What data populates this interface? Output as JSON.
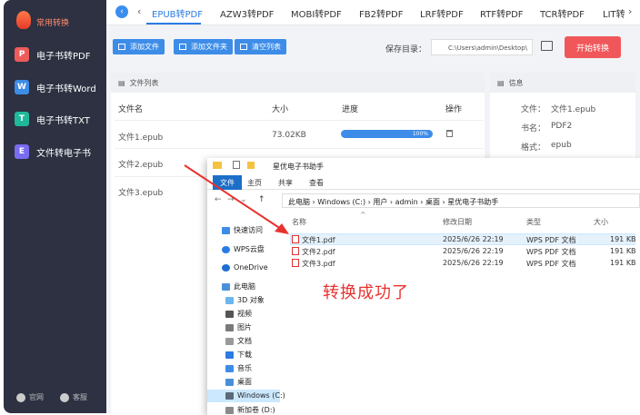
{
  "sidebar": {
    "logo_text": "常用转换",
    "items": [
      {
        "icon": "P",
        "label": "电子书转PDF",
        "color": "#ef5b5b"
      },
      {
        "icon": "W",
        "label": "电子书转Word",
        "color": "#3d8ce8"
      },
      {
        "icon": "T",
        "label": "电子书转TXT",
        "color": "#1fb89a"
      },
      {
        "icon": "E",
        "label": "文件转电子书",
        "color": "#7a6cf0"
      }
    ],
    "footer": [
      "官网",
      "客服"
    ]
  },
  "tabs": [
    "EPUB转PDF",
    "AZW3转PDF",
    "MOBI转PDF",
    "FB2转PDF",
    "LRF转PDF",
    "RTF转PDF",
    "TCR转PDF",
    "LIT转"
  ],
  "toolbar": {
    "add_file": "添加文件",
    "add_folder": "添加文件夹",
    "clear_list": "清空列表",
    "save_label": "保存目录：",
    "save_path": "C:\\Users\\admin\\Desktop\\",
    "start": "开始转换"
  },
  "file_list": {
    "title": "文件列表",
    "columns": [
      "文件名",
      "大小",
      "进度",
      "操作"
    ],
    "rows": [
      {
        "name": "文件1.epub",
        "size": "73.02KB",
        "progress": "100%"
      },
      {
        "name": "文件2.epub"
      },
      {
        "name": "文件3.epub"
      }
    ]
  },
  "info": {
    "title": "信息",
    "file_label": "文件：",
    "file_value": "文件1.epub",
    "book_label": "书名：",
    "book_value": "PDF2",
    "format_label": "格式：",
    "format_value": "epub"
  },
  "explorer": {
    "title": "星优电子书助手",
    "ribbon": [
      "文件",
      "主页",
      "共享",
      "查看"
    ],
    "breadcrumb": "此电脑 › Windows (C:) › 用户 › admin › 桌面 › 星优电子书助手",
    "nav_items": [
      "快速访问",
      "WPS云盘",
      "OneDrive",
      "此电脑",
      "3D 对象",
      "视频",
      "图片",
      "文档",
      "下载",
      "音乐",
      "桌面",
      "Windows (C:)",
      "新加卷 (D:)"
    ],
    "columns": [
      "名称",
      "修改日期",
      "类型",
      "大小"
    ],
    "files": [
      {
        "name": "文件1.pdf",
        "date": "2025/6/26 22:19",
        "type": "WPS PDF 文档",
        "size": "191 KB"
      },
      {
        "name": "文件2.pdf",
        "date": "2025/6/26 22:19",
        "type": "WPS PDF 文档",
        "size": "191 KB"
      },
      {
        "name": "文件3.pdf",
        "date": "2025/6/26 22:19",
        "type": "WPS PDF 文档",
        "size": "191 KB"
      }
    ]
  },
  "annotation": "转换成功了",
  "colors": {
    "accent": "#3d8ce8",
    "start_button": "#f0575a",
    "sidebar_bg": "#2d3142",
    "annotation": "#e8322f"
  }
}
